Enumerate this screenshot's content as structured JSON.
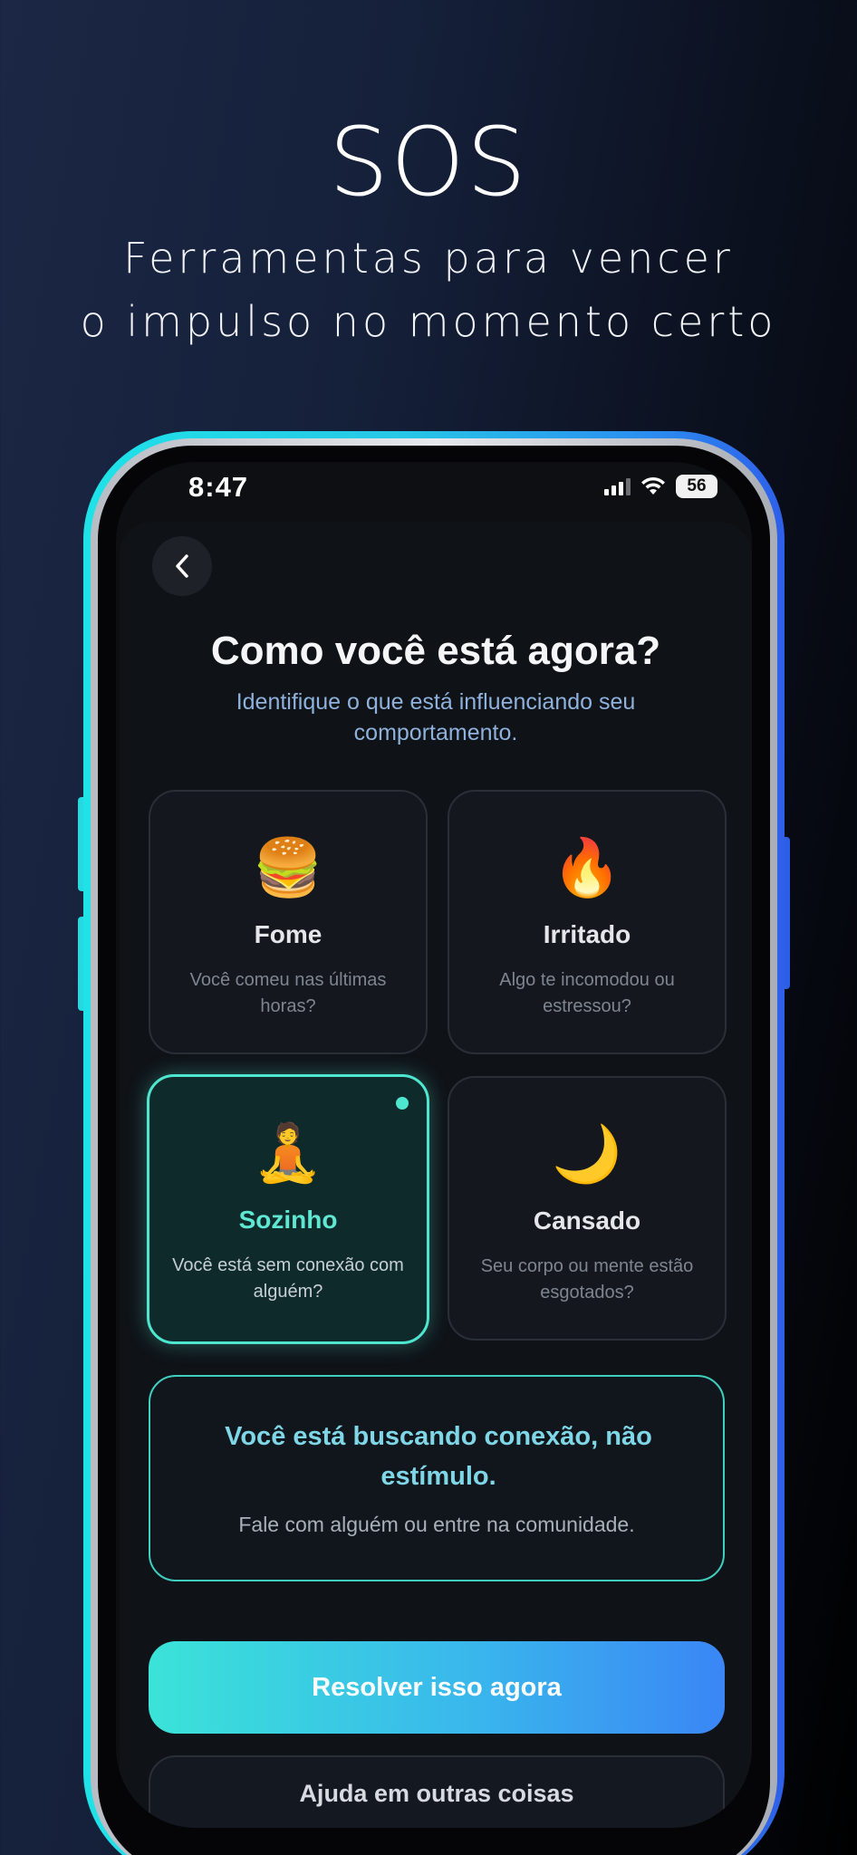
{
  "hero": {
    "title": "SOS",
    "subtitle_line1": "Ferramentas para vencer",
    "subtitle_line2": "o impulso no momento certo"
  },
  "status_bar": {
    "time": "8:47",
    "battery": "56"
  },
  "screen": {
    "back_icon": "chevron-left-icon",
    "title": "Como você está agora?",
    "subtitle": "Identifique o que está influenciando seu comportamento."
  },
  "cards": [
    {
      "id": "fome",
      "emoji": "🍔",
      "label": "Fome",
      "description": "Você comeu nas últimas horas?",
      "selected": false
    },
    {
      "id": "irritado",
      "emoji": "🔥",
      "label": "Irritado",
      "description": "Algo te incomodou ou estressou?",
      "selected": false
    },
    {
      "id": "sozinho",
      "emoji": "🧘",
      "label": "Sozinho",
      "description": "Você está sem conexão com alguém?",
      "selected": true
    },
    {
      "id": "cansado",
      "emoji": "🌙",
      "label": "Cansado",
      "description": "Seu corpo ou mente estão esgotados?",
      "selected": false
    }
  ],
  "insight": {
    "title": "Você está buscando conexão, não estímulo.",
    "text": "Fale com alguém ou entre na comunidade."
  },
  "buttons": {
    "primary": "Resolver isso agora",
    "secondary": "Ajuda em outras coisas"
  },
  "colors": {
    "accent": "#4fe6cf",
    "gradient_start": "#3be3d8",
    "gradient_end": "#3a86f5",
    "subtitle_blue": "#8fb2dc"
  }
}
